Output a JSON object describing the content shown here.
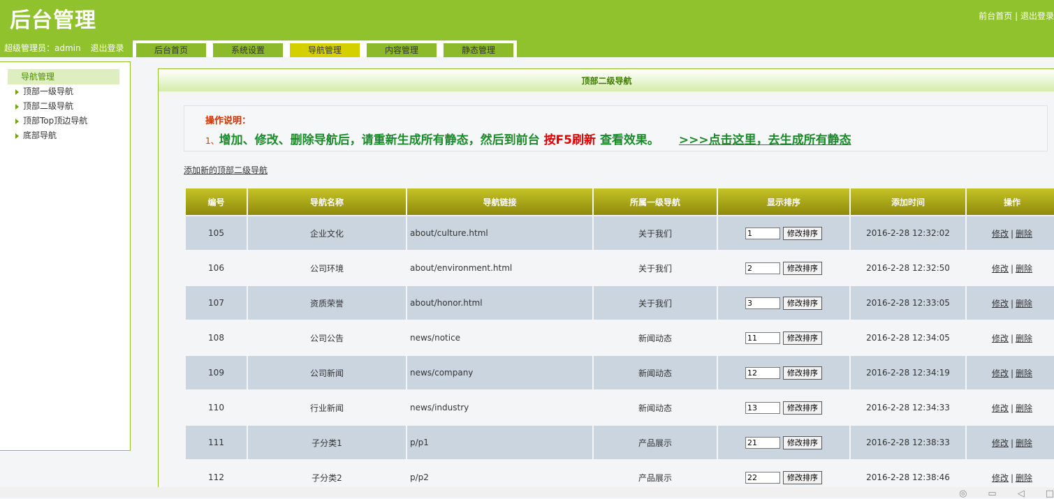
{
  "header": {
    "logo": "后台管理",
    "front_link": "前台首页",
    "separator": "|",
    "exit_link": "退出登录"
  },
  "admin_bar": {
    "user_label": "超级管理员：admin",
    "logout": "退出登录"
  },
  "tabs": [
    {
      "label": "后台首页"
    },
    {
      "label": "系统设置"
    },
    {
      "label": "导航管理",
      "active": true
    },
    {
      "label": "内容管理"
    },
    {
      "label": "静态管理"
    }
  ],
  "sidebar": {
    "title": "导航管理",
    "items": [
      {
        "label": "顶部一级导航"
      },
      {
        "label": "顶部二级导航"
      },
      {
        "label": "顶部Top顶边导航"
      },
      {
        "label": "底部导航"
      }
    ]
  },
  "main": {
    "title": "顶部二级导航",
    "notice_head": "操作说明：",
    "notice_num": "1、",
    "notice_text1": "增加、修改、删除导航后，请重新生成所有静态，然后到前台",
    "notice_f5": "按F5刷新",
    "notice_text2": "查看效果。",
    "notice_link": ">>>点击这里，去生成所有静态",
    "add_link": "添加新的顶部二级导航"
  },
  "table": {
    "headers": [
      "编号",
      "导航名称",
      "导航链接",
      "所属一级导航",
      "显示排序",
      "添加时间",
      "操作"
    ],
    "sort_button": "修改排序",
    "edit": "修改",
    "op_sep": "|",
    "delete": "删除",
    "rows": [
      {
        "id": "105",
        "name": "企业文化",
        "link": "about/culture.html",
        "parent": "关于我们",
        "order": "1",
        "time": "2016-2-28 12:32:02"
      },
      {
        "id": "106",
        "name": "公司环境",
        "link": "about/environment.html",
        "parent": "关于我们",
        "order": "2",
        "time": "2016-2-28 12:32:50"
      },
      {
        "id": "107",
        "name": "资质荣誉",
        "link": "about/honor.html",
        "parent": "关于我们",
        "order": "3",
        "time": "2016-2-28 12:33:05"
      },
      {
        "id": "108",
        "name": "公司公告",
        "link": "news/notice",
        "parent": "新闻动态",
        "order": "11",
        "time": "2016-2-28 12:34:05"
      },
      {
        "id": "109",
        "name": "公司新闻",
        "link": "news/company",
        "parent": "新闻动态",
        "order": "12",
        "time": "2016-2-28 12:34:19"
      },
      {
        "id": "110",
        "name": "行业新闻",
        "link": "news/industry",
        "parent": "新闻动态",
        "order": "13",
        "time": "2016-2-28 12:34:33"
      },
      {
        "id": "111",
        "name": "子分类1",
        "link": "p/p1",
        "parent": "产品展示",
        "order": "21",
        "time": "2016-2-28 12:38:33"
      },
      {
        "id": "112",
        "name": "子分类2",
        "link": "p/p2",
        "parent": "产品展示",
        "order": "22",
        "time": "2016-2-28 12:38:46"
      }
    ]
  },
  "colors": {
    "header_bg": "#90c22d",
    "tab_active": "#d4d000",
    "table_head": "#a8a516",
    "row_shade": "#cbd5e0",
    "notice_green": "#1a8a2a",
    "notice_red": "#e00000"
  }
}
